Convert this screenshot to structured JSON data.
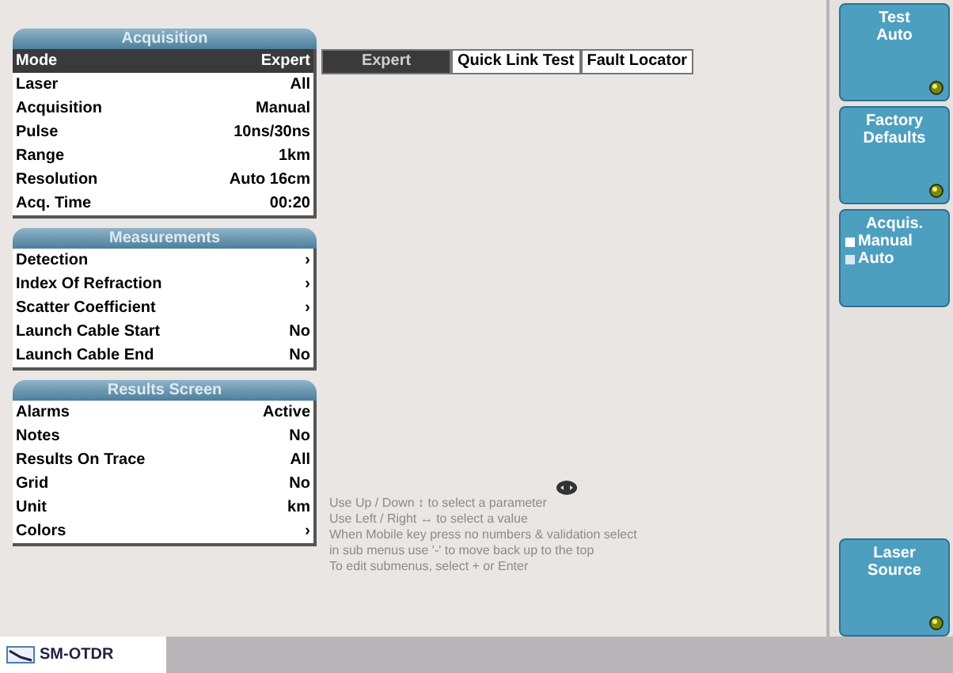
{
  "sections": [
    {
      "title": "Acquisition",
      "rows": [
        {
          "label": "Mode",
          "value": "Expert",
          "selected": true
        },
        {
          "label": "Laser",
          "value": "All",
          "selected": false
        },
        {
          "label": "Acquisition",
          "value": "Manual",
          "selected": false
        },
        {
          "label": "Pulse",
          "value": "10ns/30ns",
          "selected": false
        },
        {
          "label": "Range",
          "value": "1km",
          "selected": false
        },
        {
          "label": "Resolution",
          "value": "Auto 16cm",
          "selected": false
        },
        {
          "label": "Acq. Time",
          "value": "00:20",
          "selected": false
        }
      ]
    },
    {
      "title": "Measurements",
      "rows": [
        {
          "label": "Detection",
          "value": "›",
          "selected": false
        },
        {
          "label": "Index Of Refraction",
          "value": "›",
          "selected": false
        },
        {
          "label": "Scatter Coefficient",
          "value": "›",
          "selected": false
        },
        {
          "label": "Launch Cable Start",
          "value": "No",
          "selected": false
        },
        {
          "label": "Launch Cable End",
          "value": "No",
          "selected": false
        }
      ]
    },
    {
      "title": "Results Screen",
      "rows": [
        {
          "label": "Alarms",
          "value": "Active",
          "selected": false
        },
        {
          "label": "Notes",
          "value": "No",
          "selected": false
        },
        {
          "label": "Results On Trace",
          "value": "All",
          "selected": false
        },
        {
          "label": "Grid",
          "value": "No",
          "selected": false
        },
        {
          "label": "Unit",
          "value": "km",
          "selected": false
        },
        {
          "label": "Colors",
          "value": "›",
          "selected": false
        }
      ]
    }
  ],
  "options": [
    {
      "label": "Expert",
      "selected": true
    },
    {
      "label": "Quick Link Test",
      "selected": false
    },
    {
      "label": "Fault Locator",
      "selected": false
    }
  ],
  "help": [
    "Use Up / Down ↕ to select a parameter",
    "Use Left / Right ↔ to select a value",
    "When Mobile key press no numbers & validation select",
    "in sub menus use '-' to move back up to the top",
    "To edit submenus, select + or Enter"
  ],
  "side_buttons": [
    {
      "kind": "action",
      "lines": [
        "Test",
        "Auto"
      ]
    },
    {
      "kind": "action",
      "lines": [
        "Factory",
        "Defaults"
      ]
    },
    {
      "kind": "radio",
      "lines": [
        "Acquis."
      ],
      "choices": [
        {
          "label": "Manual",
          "selected": true
        },
        {
          "label": "Auto",
          "selected": false
        }
      ]
    },
    {
      "kind": "action",
      "lines": [
        "Laser",
        "Source"
      ]
    }
  ],
  "status_bar": {
    "tab": "SM-OTDR"
  }
}
